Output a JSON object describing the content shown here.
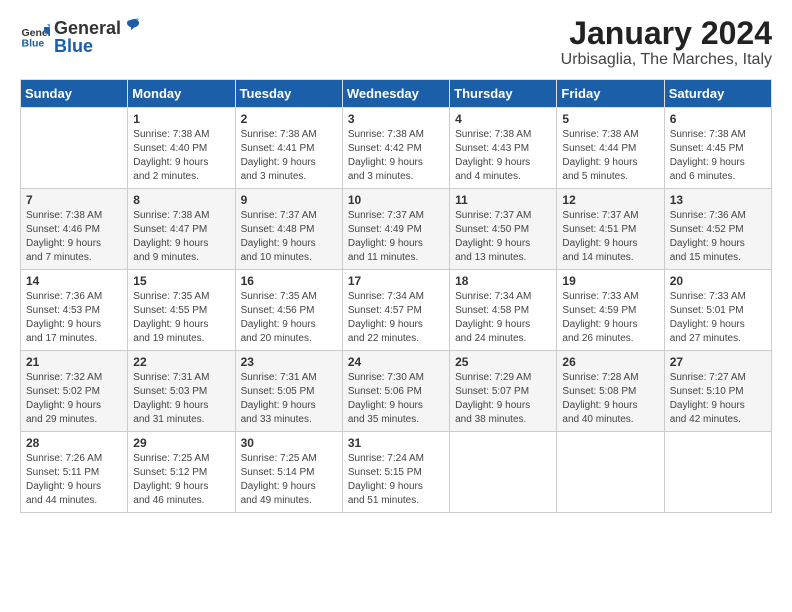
{
  "logo": {
    "general": "General",
    "blue": "Blue"
  },
  "title": "January 2024",
  "subtitle": "Urbisaglia, The Marches, Italy",
  "days_of_week": [
    "Sunday",
    "Monday",
    "Tuesday",
    "Wednesday",
    "Thursday",
    "Friday",
    "Saturday"
  ],
  "weeks": [
    [
      {
        "day": "",
        "info": ""
      },
      {
        "day": "1",
        "info": "Sunrise: 7:38 AM\nSunset: 4:40 PM\nDaylight: 9 hours\nand 2 minutes."
      },
      {
        "day": "2",
        "info": "Sunrise: 7:38 AM\nSunset: 4:41 PM\nDaylight: 9 hours\nand 3 minutes."
      },
      {
        "day": "3",
        "info": "Sunrise: 7:38 AM\nSunset: 4:42 PM\nDaylight: 9 hours\nand 3 minutes."
      },
      {
        "day": "4",
        "info": "Sunrise: 7:38 AM\nSunset: 4:43 PM\nDaylight: 9 hours\nand 4 minutes."
      },
      {
        "day": "5",
        "info": "Sunrise: 7:38 AM\nSunset: 4:44 PM\nDaylight: 9 hours\nand 5 minutes."
      },
      {
        "day": "6",
        "info": "Sunrise: 7:38 AM\nSunset: 4:45 PM\nDaylight: 9 hours\nand 6 minutes."
      }
    ],
    [
      {
        "day": "7",
        "info": "Sunrise: 7:38 AM\nSunset: 4:46 PM\nDaylight: 9 hours\nand 7 minutes."
      },
      {
        "day": "8",
        "info": "Sunrise: 7:38 AM\nSunset: 4:47 PM\nDaylight: 9 hours\nand 9 minutes."
      },
      {
        "day": "9",
        "info": "Sunrise: 7:37 AM\nSunset: 4:48 PM\nDaylight: 9 hours\nand 10 minutes."
      },
      {
        "day": "10",
        "info": "Sunrise: 7:37 AM\nSunset: 4:49 PM\nDaylight: 9 hours\nand 11 minutes."
      },
      {
        "day": "11",
        "info": "Sunrise: 7:37 AM\nSunset: 4:50 PM\nDaylight: 9 hours\nand 13 minutes."
      },
      {
        "day": "12",
        "info": "Sunrise: 7:37 AM\nSunset: 4:51 PM\nDaylight: 9 hours\nand 14 minutes."
      },
      {
        "day": "13",
        "info": "Sunrise: 7:36 AM\nSunset: 4:52 PM\nDaylight: 9 hours\nand 15 minutes."
      }
    ],
    [
      {
        "day": "14",
        "info": "Sunrise: 7:36 AM\nSunset: 4:53 PM\nDaylight: 9 hours\nand 17 minutes."
      },
      {
        "day": "15",
        "info": "Sunrise: 7:35 AM\nSunset: 4:55 PM\nDaylight: 9 hours\nand 19 minutes."
      },
      {
        "day": "16",
        "info": "Sunrise: 7:35 AM\nSunset: 4:56 PM\nDaylight: 9 hours\nand 20 minutes."
      },
      {
        "day": "17",
        "info": "Sunrise: 7:34 AM\nSunset: 4:57 PM\nDaylight: 9 hours\nand 22 minutes."
      },
      {
        "day": "18",
        "info": "Sunrise: 7:34 AM\nSunset: 4:58 PM\nDaylight: 9 hours\nand 24 minutes."
      },
      {
        "day": "19",
        "info": "Sunrise: 7:33 AM\nSunset: 4:59 PM\nDaylight: 9 hours\nand 26 minutes."
      },
      {
        "day": "20",
        "info": "Sunrise: 7:33 AM\nSunset: 5:01 PM\nDaylight: 9 hours\nand 27 minutes."
      }
    ],
    [
      {
        "day": "21",
        "info": "Sunrise: 7:32 AM\nSunset: 5:02 PM\nDaylight: 9 hours\nand 29 minutes."
      },
      {
        "day": "22",
        "info": "Sunrise: 7:31 AM\nSunset: 5:03 PM\nDaylight: 9 hours\nand 31 minutes."
      },
      {
        "day": "23",
        "info": "Sunrise: 7:31 AM\nSunset: 5:05 PM\nDaylight: 9 hours\nand 33 minutes."
      },
      {
        "day": "24",
        "info": "Sunrise: 7:30 AM\nSunset: 5:06 PM\nDaylight: 9 hours\nand 35 minutes."
      },
      {
        "day": "25",
        "info": "Sunrise: 7:29 AM\nSunset: 5:07 PM\nDaylight: 9 hours\nand 38 minutes."
      },
      {
        "day": "26",
        "info": "Sunrise: 7:28 AM\nSunset: 5:08 PM\nDaylight: 9 hours\nand 40 minutes."
      },
      {
        "day": "27",
        "info": "Sunrise: 7:27 AM\nSunset: 5:10 PM\nDaylight: 9 hours\nand 42 minutes."
      }
    ],
    [
      {
        "day": "28",
        "info": "Sunrise: 7:26 AM\nSunset: 5:11 PM\nDaylight: 9 hours\nand 44 minutes."
      },
      {
        "day": "29",
        "info": "Sunrise: 7:25 AM\nSunset: 5:12 PM\nDaylight: 9 hours\nand 46 minutes."
      },
      {
        "day": "30",
        "info": "Sunrise: 7:25 AM\nSunset: 5:14 PM\nDaylight: 9 hours\nand 49 minutes."
      },
      {
        "day": "31",
        "info": "Sunrise: 7:24 AM\nSunset: 5:15 PM\nDaylight: 9 hours\nand 51 minutes."
      },
      {
        "day": "",
        "info": ""
      },
      {
        "day": "",
        "info": ""
      },
      {
        "day": "",
        "info": ""
      }
    ]
  ]
}
